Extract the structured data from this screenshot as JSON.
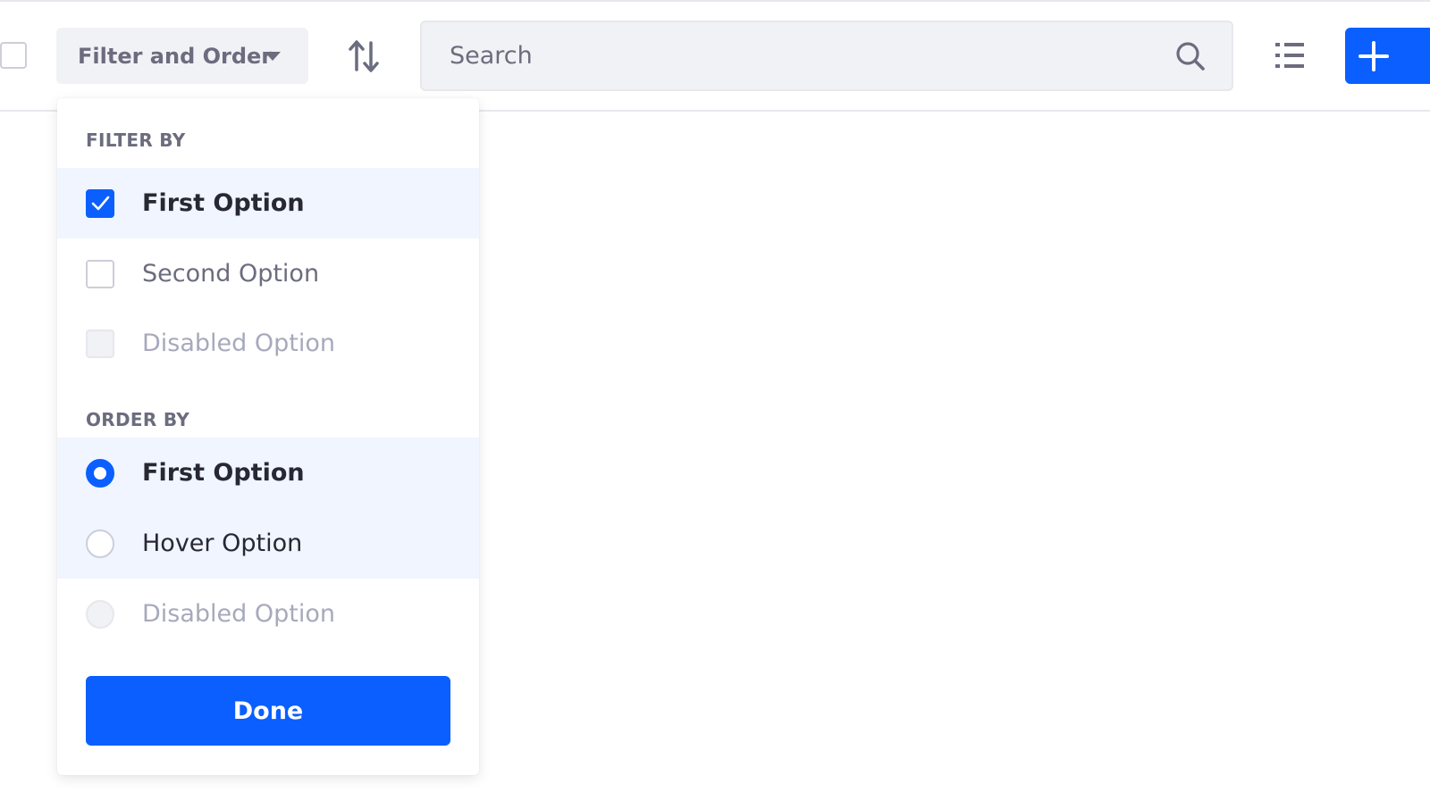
{
  "toolbar": {
    "filter_button_label": "Filter and Order",
    "search_placeholder": "Search",
    "icons": {
      "caret": "caret-down-icon",
      "sort": "sort-arrows-icon",
      "search": "search-icon",
      "list_view": "list-view-icon",
      "add": "plus-icon"
    }
  },
  "dropdown": {
    "filter_section": {
      "header": "FILTER BY",
      "options": [
        {
          "label": "First Option",
          "checked": true,
          "disabled": false
        },
        {
          "label": "Second Option",
          "checked": false,
          "disabled": false
        },
        {
          "label": "Disabled Option",
          "checked": false,
          "disabled": true
        }
      ]
    },
    "order_section": {
      "header": "ORDER BY",
      "options": [
        {
          "label": "First Option",
          "selected": true,
          "disabled": false
        },
        {
          "label": "Hover Option",
          "selected": false,
          "disabled": false
        },
        {
          "label": "Disabled Option",
          "selected": false,
          "disabled": true
        }
      ]
    },
    "done_label": "Done"
  },
  "colors": {
    "primary": "#0b5fff",
    "active_row_bg": "#f0f5ff",
    "secondary_text": "#6b6c7e",
    "disabled_text": "#a7a9bc"
  }
}
